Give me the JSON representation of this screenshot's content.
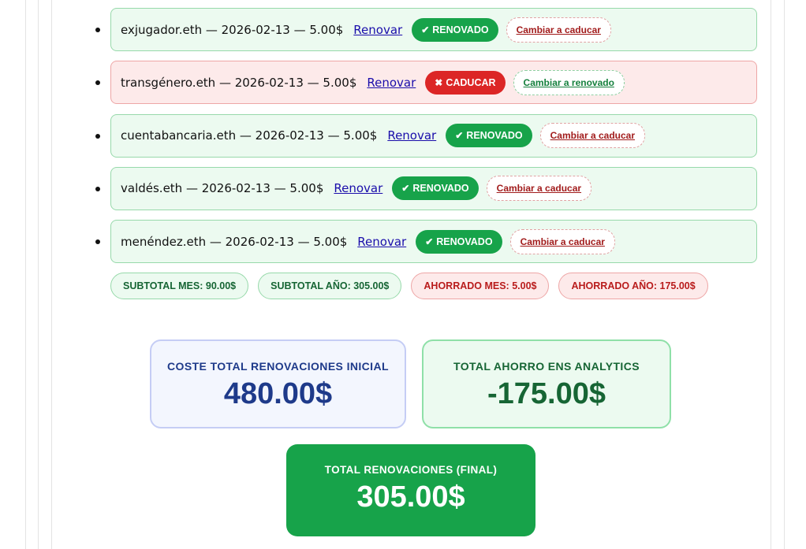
{
  "domains": [
    {
      "text": "exjugador.eth — 2026-02-13 — 5.00$",
      "renew_label": "Renovar",
      "status_glyph": "✔",
      "status_label": "RENOVADO",
      "status": "renewed",
      "toggle_label": "Cambiar a caducar"
    },
    {
      "text": "transgénero.eth — 2026-02-13 — 5.00$",
      "renew_label": "Renovar",
      "status_glyph": "✖",
      "status_label": "CADUCAR",
      "status": "expire",
      "toggle_label": "Cambiar a renovado"
    },
    {
      "text": "cuentabancaria.eth — 2026-02-13 — 5.00$",
      "renew_label": "Renovar",
      "status_glyph": "✔",
      "status_label": "RENOVADO",
      "status": "renewed",
      "toggle_label": "Cambiar a caducar"
    },
    {
      "text": "valdés.eth — 2026-02-13 — 5.00$",
      "renew_label": "Renovar",
      "status_glyph": "✔",
      "status_label": "RENOVADO",
      "status": "renewed",
      "toggle_label": "Cambiar a caducar"
    },
    {
      "text": "menéndez.eth — 2026-02-13 — 5.00$",
      "renew_label": "Renovar",
      "status_glyph": "✔",
      "status_label": "RENOVADO",
      "status": "renewed",
      "toggle_label": "Cambiar a caducar"
    }
  ],
  "subtotals": {
    "month": "SUBTOTAL MES: 90.00$",
    "year": "SUBTOTAL AÑO: 305.00$",
    "saved_month": "AHORRADO MES: 5.00$",
    "saved_year": "AHORRADO AÑO: 175.00$"
  },
  "cards": {
    "initial": {
      "label": "COSTE TOTAL RENOVACIONES INICIAL",
      "value": "480.00$"
    },
    "savings": {
      "label": "TOTAL AHORRO ENS ANALYTICS",
      "value": "-175.00$"
    },
    "final": {
      "label": "TOTAL RENOVACIONES (FINAL)",
      "value": "305.00$"
    }
  },
  "colors": {
    "renewed": "#17a34a",
    "expire": "#dc2626",
    "link": "#1a0dab",
    "initial_text": "#1e3a8a",
    "savings_text": "#166534"
  }
}
